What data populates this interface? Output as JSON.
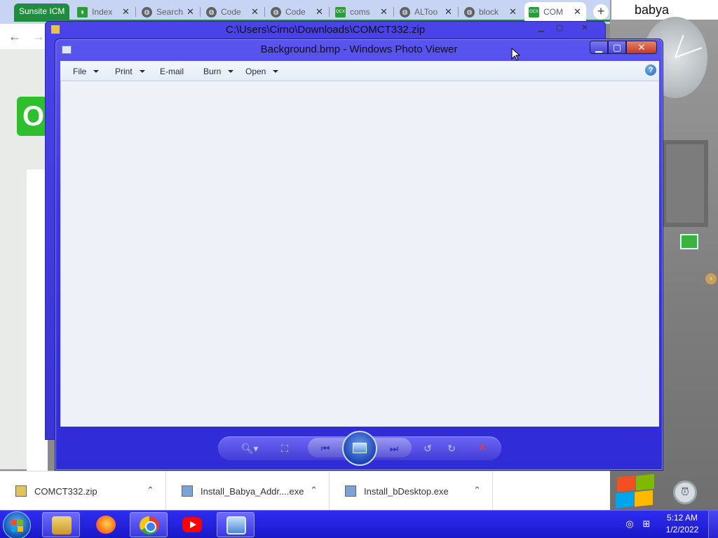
{
  "browser": {
    "group_label": "Sunsite ICM",
    "tabs": [
      {
        "label": "Index",
        "icon": "chart-favicon"
      },
      {
        "label": "Search",
        "icon": "globe-favicon"
      },
      {
        "label": "Code",
        "icon": "globe-favicon"
      },
      {
        "label": "Code",
        "icon": "globe-favicon"
      },
      {
        "label": "coms",
        "icon": "ocx-favicon"
      },
      {
        "label": "ALToo",
        "icon": "globe-favicon"
      },
      {
        "label": "block",
        "icon": "globe-favicon"
      },
      {
        "label": "COM",
        "icon": "ocx-favicon"
      }
    ],
    "ocx_badge": "OCX",
    "close_glyph": "✕",
    "new_tab_glyph": "+",
    "back_glyph": "←",
    "forward_glyph": "→",
    "page_logo": "O"
  },
  "desktop": {
    "user_name": "babya"
  },
  "zip_window": {
    "title": "C:\\Users\\Cirno\\Downloads\\COMCT332.zip",
    "controls": {
      "minimize": "▁",
      "maximize": "▢",
      "close": "✕"
    }
  },
  "viewer": {
    "title": "Background.bmp - Windows Photo Viewer",
    "controls": {
      "minimize": "▁",
      "maximize": "▢",
      "close": "✕"
    },
    "menu": [
      {
        "label": "File",
        "has_dropdown": true
      },
      {
        "label": "Print",
        "has_dropdown": true
      },
      {
        "label": "E-mail",
        "has_dropdown": false
      },
      {
        "label": "Burn",
        "has_dropdown": true
      },
      {
        "label": "Open",
        "has_dropdown": true
      }
    ],
    "help_glyph": "?",
    "toolbar_icons": [
      "zoom-icon",
      "actual-size-icon",
      "previous-icon",
      "slideshow-icon",
      "next-icon",
      "rotate-counterclockwise-icon",
      "rotate-clockwise-icon",
      "delete-icon"
    ],
    "glyphs": {
      "zoom": "🔍︎▾",
      "actual_size": "⛶",
      "previous": "⏮",
      "next": "⏭",
      "rotate_ccw": "↺",
      "rotate_cw": "↻",
      "delete": "✕"
    }
  },
  "downloads": [
    {
      "name": "COMCT332.zip",
      "icon": "zip-file-icon"
    },
    {
      "name": "Install_Babya_Addr....exe",
      "icon": "exe-file-icon"
    },
    {
      "name": "Install_bDesktop.exe",
      "icon": "exe-file-icon"
    }
  ],
  "download_chevron": "⌃",
  "taskbar": {
    "time": "5:12 AM",
    "date": "1/2/2022",
    "pinned": [
      "file-explorer-icon",
      "firefox-icon",
      "chrome-icon",
      "youtube-icon",
      "photo-viewer-icon"
    ],
    "tray": [
      "action-center-icon",
      "network-icon"
    ]
  },
  "colors": {
    "window_frame": "#3b36e0",
    "taskbar": "#2321e0",
    "tab_group": "#1e8e3e",
    "viewer_canvas": "#eef2f8"
  }
}
